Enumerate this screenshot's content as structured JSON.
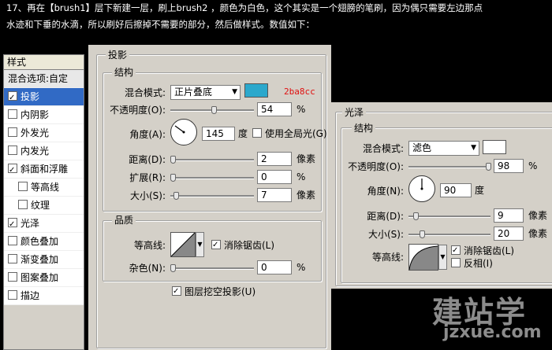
{
  "caption": {
    "line1": "17、再在【brush1】层下新建一层，刷上brush2 ，颜色为白色，这个其实是一个翅膀的笔刷，因为偶只需要左边那点",
    "line2": "水迹和下垂的水滴，所以刷好后擦掉不需要的部分，然后做样式。数值如下："
  },
  "styles_panel": {
    "title": "样式",
    "blend_options": "混合选项:自定",
    "items": [
      {
        "label": "投影",
        "checked": true
      },
      {
        "label": "内阴影",
        "checked": false
      },
      {
        "label": "外发光",
        "checked": false
      },
      {
        "label": "内发光",
        "checked": false
      },
      {
        "label": "斜面和浮雕",
        "checked": true
      },
      {
        "label": "等高线",
        "checked": false
      },
      {
        "label": "纹理",
        "checked": false
      },
      {
        "label": "光泽",
        "checked": true
      },
      {
        "label": "颜色叠加",
        "checked": false
      },
      {
        "label": "渐变叠加",
        "checked": false
      },
      {
        "label": "图案叠加",
        "checked": false
      },
      {
        "label": "描边",
        "checked": false
      }
    ]
  },
  "drop_shadow": {
    "title": "投影",
    "structure_title": "结构",
    "blend_mode_label": "混合模式:",
    "blend_mode_value": "正片叠底",
    "color": "#2ba8cc",
    "color_hex_text": "2ba8cc",
    "opacity_label": "不透明度(O):",
    "opacity_value": "54",
    "opacity_unit": "%",
    "angle_label": "角度(A):",
    "angle_value": "145",
    "angle_unit": "度",
    "global_light_label": "使用全局光(G)",
    "global_light_checked": false,
    "distance_label": "距离(D):",
    "distance_value": "2",
    "distance_unit": "像素",
    "spread_label": "扩展(R):",
    "spread_value": "0",
    "spread_unit": "%",
    "size_label": "大小(S):",
    "size_value": "7",
    "size_unit": "像素",
    "quality_title": "品质",
    "contour_label": "等高线:",
    "antialias_label": "消除锯齿(L)",
    "antialias_checked": true,
    "noise_label": "杂色(N):",
    "noise_value": "0",
    "noise_unit": "%",
    "knockout_label": "图层挖空投影(U)",
    "knockout_checked": true
  },
  "satin": {
    "title": "光泽",
    "structure_title": "结构",
    "blend_mode_label": "混合模式:",
    "blend_mode_value": "滤色",
    "color": "#ffffff",
    "opacity_label": "不透明度(O):",
    "opacity_value": "98",
    "opacity_unit": "%",
    "angle_label": "角度(N):",
    "angle_value": "90",
    "angle_unit": "度",
    "distance_label": "距离(D):",
    "distance_value": "9",
    "distance_unit": "像素",
    "size_label": "大小(S):",
    "size_value": "20",
    "size_unit": "像素",
    "contour_label": "等高线:",
    "antialias_label": "消除锯齿(L)",
    "antialias_checked": true,
    "invert_label": "反相(I)",
    "invert_checked": false
  },
  "watermark": {
    "line1": "建站学",
    "line2": "jzxue.com"
  }
}
